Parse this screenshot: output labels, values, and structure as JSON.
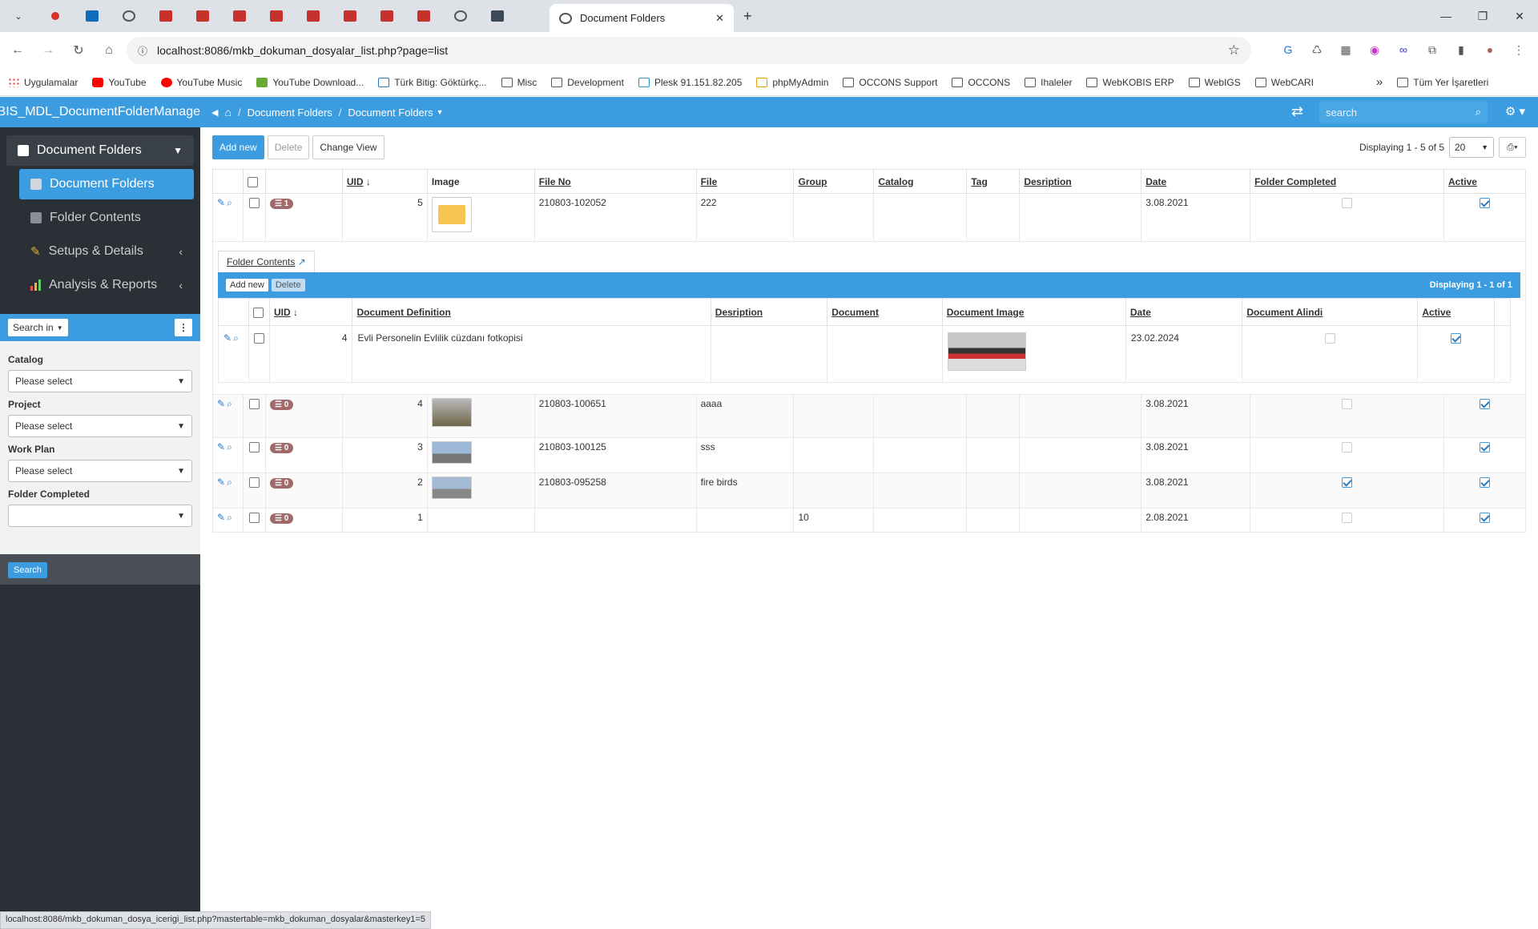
{
  "browser": {
    "active_tab_title": "Document Folders",
    "url": "localhost:8086/mkb_dokuman_dosyalar_list.php?page=list",
    "bookmarks": [
      {
        "label": "Uygulamalar",
        "icon": "apps-grid-icon"
      },
      {
        "label": "YouTube",
        "icon": "youtube-icon"
      },
      {
        "label": "YouTube Music",
        "icon": "youtube-music-icon"
      },
      {
        "label": "YouTube Download...",
        "icon": "download-icon"
      },
      {
        "label": "Türk Bitig: Göktürkç...",
        "icon": "bitig-icon"
      },
      {
        "label": "Misc",
        "icon": "folder-icon"
      },
      {
        "label": "Development",
        "icon": "folder-icon"
      },
      {
        "label": "Plesk 91.151.82.205",
        "icon": "plesk-icon"
      },
      {
        "label": "phpMyAdmin",
        "icon": "phpmyadmin-icon"
      },
      {
        "label": "OCCONS Support",
        "icon": "folder-icon"
      },
      {
        "label": "OCCONS",
        "icon": "folder-icon"
      },
      {
        "label": "Ihaleler",
        "icon": "folder-icon"
      },
      {
        "label": "WebKOBIS ERP",
        "icon": "folder-icon"
      },
      {
        "label": "WebIGS",
        "icon": "folder-icon"
      },
      {
        "label": "WebCARI",
        "icon": "folder-icon"
      }
    ],
    "bookmarks_overflow": "»",
    "other_bookmarks": "Tüm Yer İşaretleri",
    "status_url": "localhost:8086/mkb_dokuman_dosya_icerigi_list.php?mastertable=mkb_dokuman_dosyalar&masterkey1=5"
  },
  "app": {
    "brand": "KOBIS_MDL_DocumentFolderManage",
    "breadcrumb": [
      "Document Folders",
      "Document Folders"
    ],
    "search_placeholder": "search"
  },
  "sidebar": {
    "group": "Document Folders",
    "items": [
      {
        "label": "Document Folders",
        "active": true
      },
      {
        "label": "Folder Contents",
        "active": false
      },
      {
        "label": "Setups & Details",
        "active": false
      },
      {
        "label": "Analysis & Reports",
        "active": false
      }
    ],
    "search_in": "Search in",
    "filters": [
      {
        "label": "Catalog",
        "value": "Please select"
      },
      {
        "label": "Project",
        "value": "Please select"
      },
      {
        "label": "Work Plan",
        "value": "Please select"
      },
      {
        "label": "Folder Completed",
        "value": ""
      }
    ],
    "search_button": "Search"
  },
  "toolbar": {
    "add_new": "Add new",
    "delete": "Delete",
    "change_view": "Change View",
    "displaying": "Displaying 1 - 5 of 5",
    "page_size": "20"
  },
  "grid": {
    "columns": [
      "UID",
      "Image",
      "File No",
      "File",
      "Group",
      "Catalog",
      "Tag",
      "Desription",
      "Date",
      "Folder Completed",
      "Active"
    ],
    "rows": [
      {
        "badge": "1",
        "uid": "5",
        "image": "folder",
        "file_no": "210803-102052",
        "file": "222",
        "group": "",
        "date": "3.08.2021",
        "completed": false,
        "active": true
      },
      {
        "badge": "0",
        "uid": "4",
        "image": "photo1",
        "file_no": "210803-100651",
        "file": "aaaa",
        "group": "",
        "date": "3.08.2021",
        "completed": false,
        "active": true
      },
      {
        "badge": "0",
        "uid": "3",
        "image": "photo2",
        "file_no": "210803-100125",
        "file": "sss",
        "group": "",
        "date": "3.08.2021",
        "completed": false,
        "active": true
      },
      {
        "badge": "0",
        "uid": "2",
        "image": "photo3",
        "file_no": "210803-095258",
        "file": "fire birds",
        "group": "",
        "date": "3.08.2021",
        "completed": true,
        "active": true
      },
      {
        "badge": "0",
        "uid": "1",
        "image": "",
        "file_no": "",
        "file": "",
        "group": "10",
        "date": "2.08.2021",
        "completed": false,
        "active": true
      }
    ]
  },
  "detail": {
    "tab": "Folder Contents",
    "add_new": "Add new",
    "delete": "Delete",
    "displaying": "Displaying 1 - 1 of 1",
    "columns": [
      "UID",
      "Document Definition",
      "Desription",
      "Document",
      "Document Image",
      "Date",
      "Document Alindi",
      "Active"
    ],
    "row": {
      "uid": "4",
      "definition": "Evli Personelin Evlilik cüzdanı fotkopisi",
      "date": "23.02.2024",
      "alindi": false,
      "active": true
    }
  }
}
